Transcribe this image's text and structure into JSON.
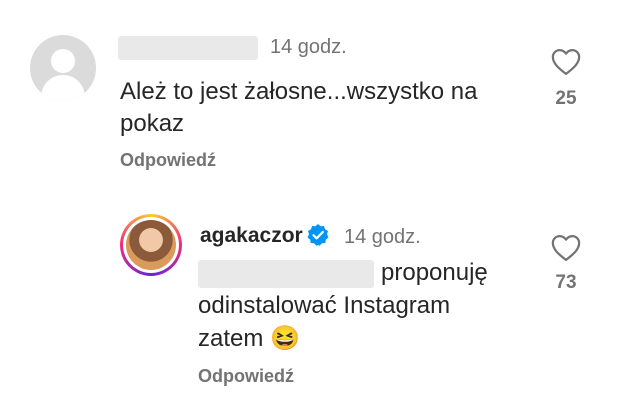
{
  "comment1": {
    "time": "14 godz.",
    "text_line1": "Ależ to jest żałosne...wszystko na",
    "text_line2": "pokaz",
    "reply_label": "Odpowiedź",
    "likes": "25"
  },
  "comment2": {
    "username": "agakaczor",
    "time": "14 godz.",
    "text_line1": "proponuję",
    "text_line2": "odinstalować Instagram",
    "text_line3": "zatem",
    "emoji": "😆",
    "reply_label": "Odpowiedź",
    "likes": "73"
  },
  "icons": {
    "heart": "heart-icon",
    "verified": "verified-badge-icon",
    "avatar": "default-avatar-icon"
  },
  "colors": {
    "verified_blue": "#0095f6",
    "text_primary": "#262626",
    "text_secondary": "#737373"
  }
}
